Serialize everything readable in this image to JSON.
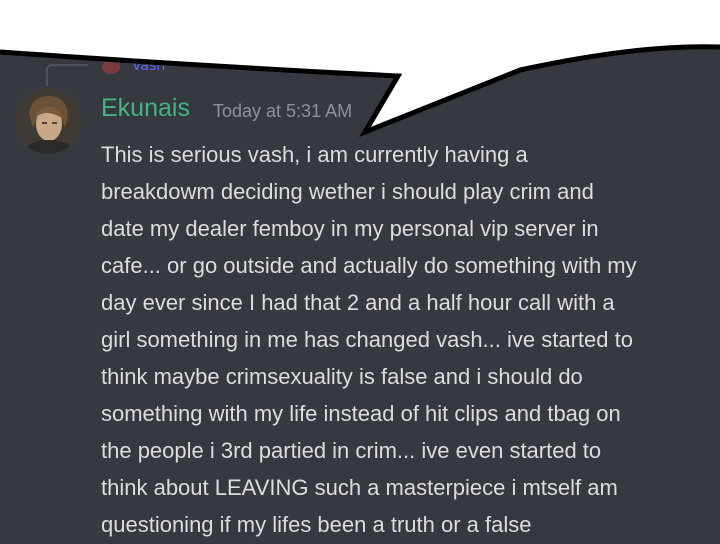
{
  "reply": {
    "name": "Vash"
  },
  "message": {
    "username": "Ekunais",
    "timestamp": "Today at 5:31 AM",
    "lines": [
      "This is serious vash, i am currently having a",
      "breakdowm deciding wether i should play crim and",
      "date my dealer femboy in my personal vip server in",
      "cafe... or go outside and actually do something with my",
      "day ever since I had that 2 and a half hour call with a",
      "girl something in me has changed vash... ive started to",
      "think maybe crimsexuality is false and i should do",
      "something with my life instead of hit clips and tbag on",
      "the people i 3rd partied in crim... ive even started to",
      "think about LEAVING such a masterpiece i mtself am",
      "questioning if my lifes been a truth or a false"
    ]
  },
  "colors": {
    "background": "#36393f",
    "username": "#43b581",
    "timestamp": "#8e9297",
    "text": "#dcddde"
  },
  "icons": {
    "avatar": "user-avatar",
    "reply_avatar": "reply-avatar"
  }
}
